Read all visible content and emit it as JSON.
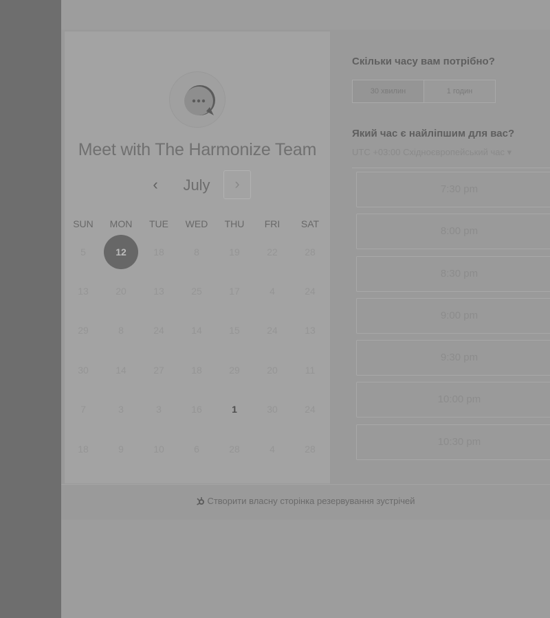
{
  "card": {
    "title": "Meet with The Harmonize Team"
  },
  "calendar": {
    "month": "July",
    "prev_icon": "‹",
    "next_icon": "›",
    "weekdays": [
      "SUN",
      "MON",
      "TUE",
      "WED",
      "THU",
      "FRI",
      "SAT"
    ],
    "weeks": [
      [
        "5",
        "12",
        "18",
        "8",
        "19",
        "22",
        "28"
      ],
      [
        "13",
        "20",
        "13",
        "25",
        "17",
        "4",
        "24"
      ],
      [
        "29",
        "8",
        "24",
        "14",
        "15",
        "24",
        "13"
      ],
      [
        "30",
        "14",
        "27",
        "18",
        "29",
        "20",
        "11"
      ],
      [
        "7",
        "3",
        "3",
        "16",
        "1",
        "30",
        "24"
      ],
      [
        "18",
        "9",
        "10",
        "6",
        "28",
        "4",
        "28"
      ]
    ],
    "selected_day": "12",
    "available_day": "1"
  },
  "duration": {
    "label": "Скільки часу вам потрібно?",
    "options": [
      "30 хвилин",
      "1 годин"
    ]
  },
  "times": {
    "label": "Який час є найліпшим для вас?",
    "timezone": "UTC +03:00 Східноєвропейський час ▾",
    "slots": [
      "7:30 pm",
      "8:00 pm",
      "8:30 pm",
      "9:00 pm",
      "9:30 pm",
      "10:00 pm",
      "10:30 pm"
    ]
  },
  "footer": {
    "icon": "hubspot-sprocket-icon",
    "link": "Створити власну сторінка резервування зустрічей"
  }
}
